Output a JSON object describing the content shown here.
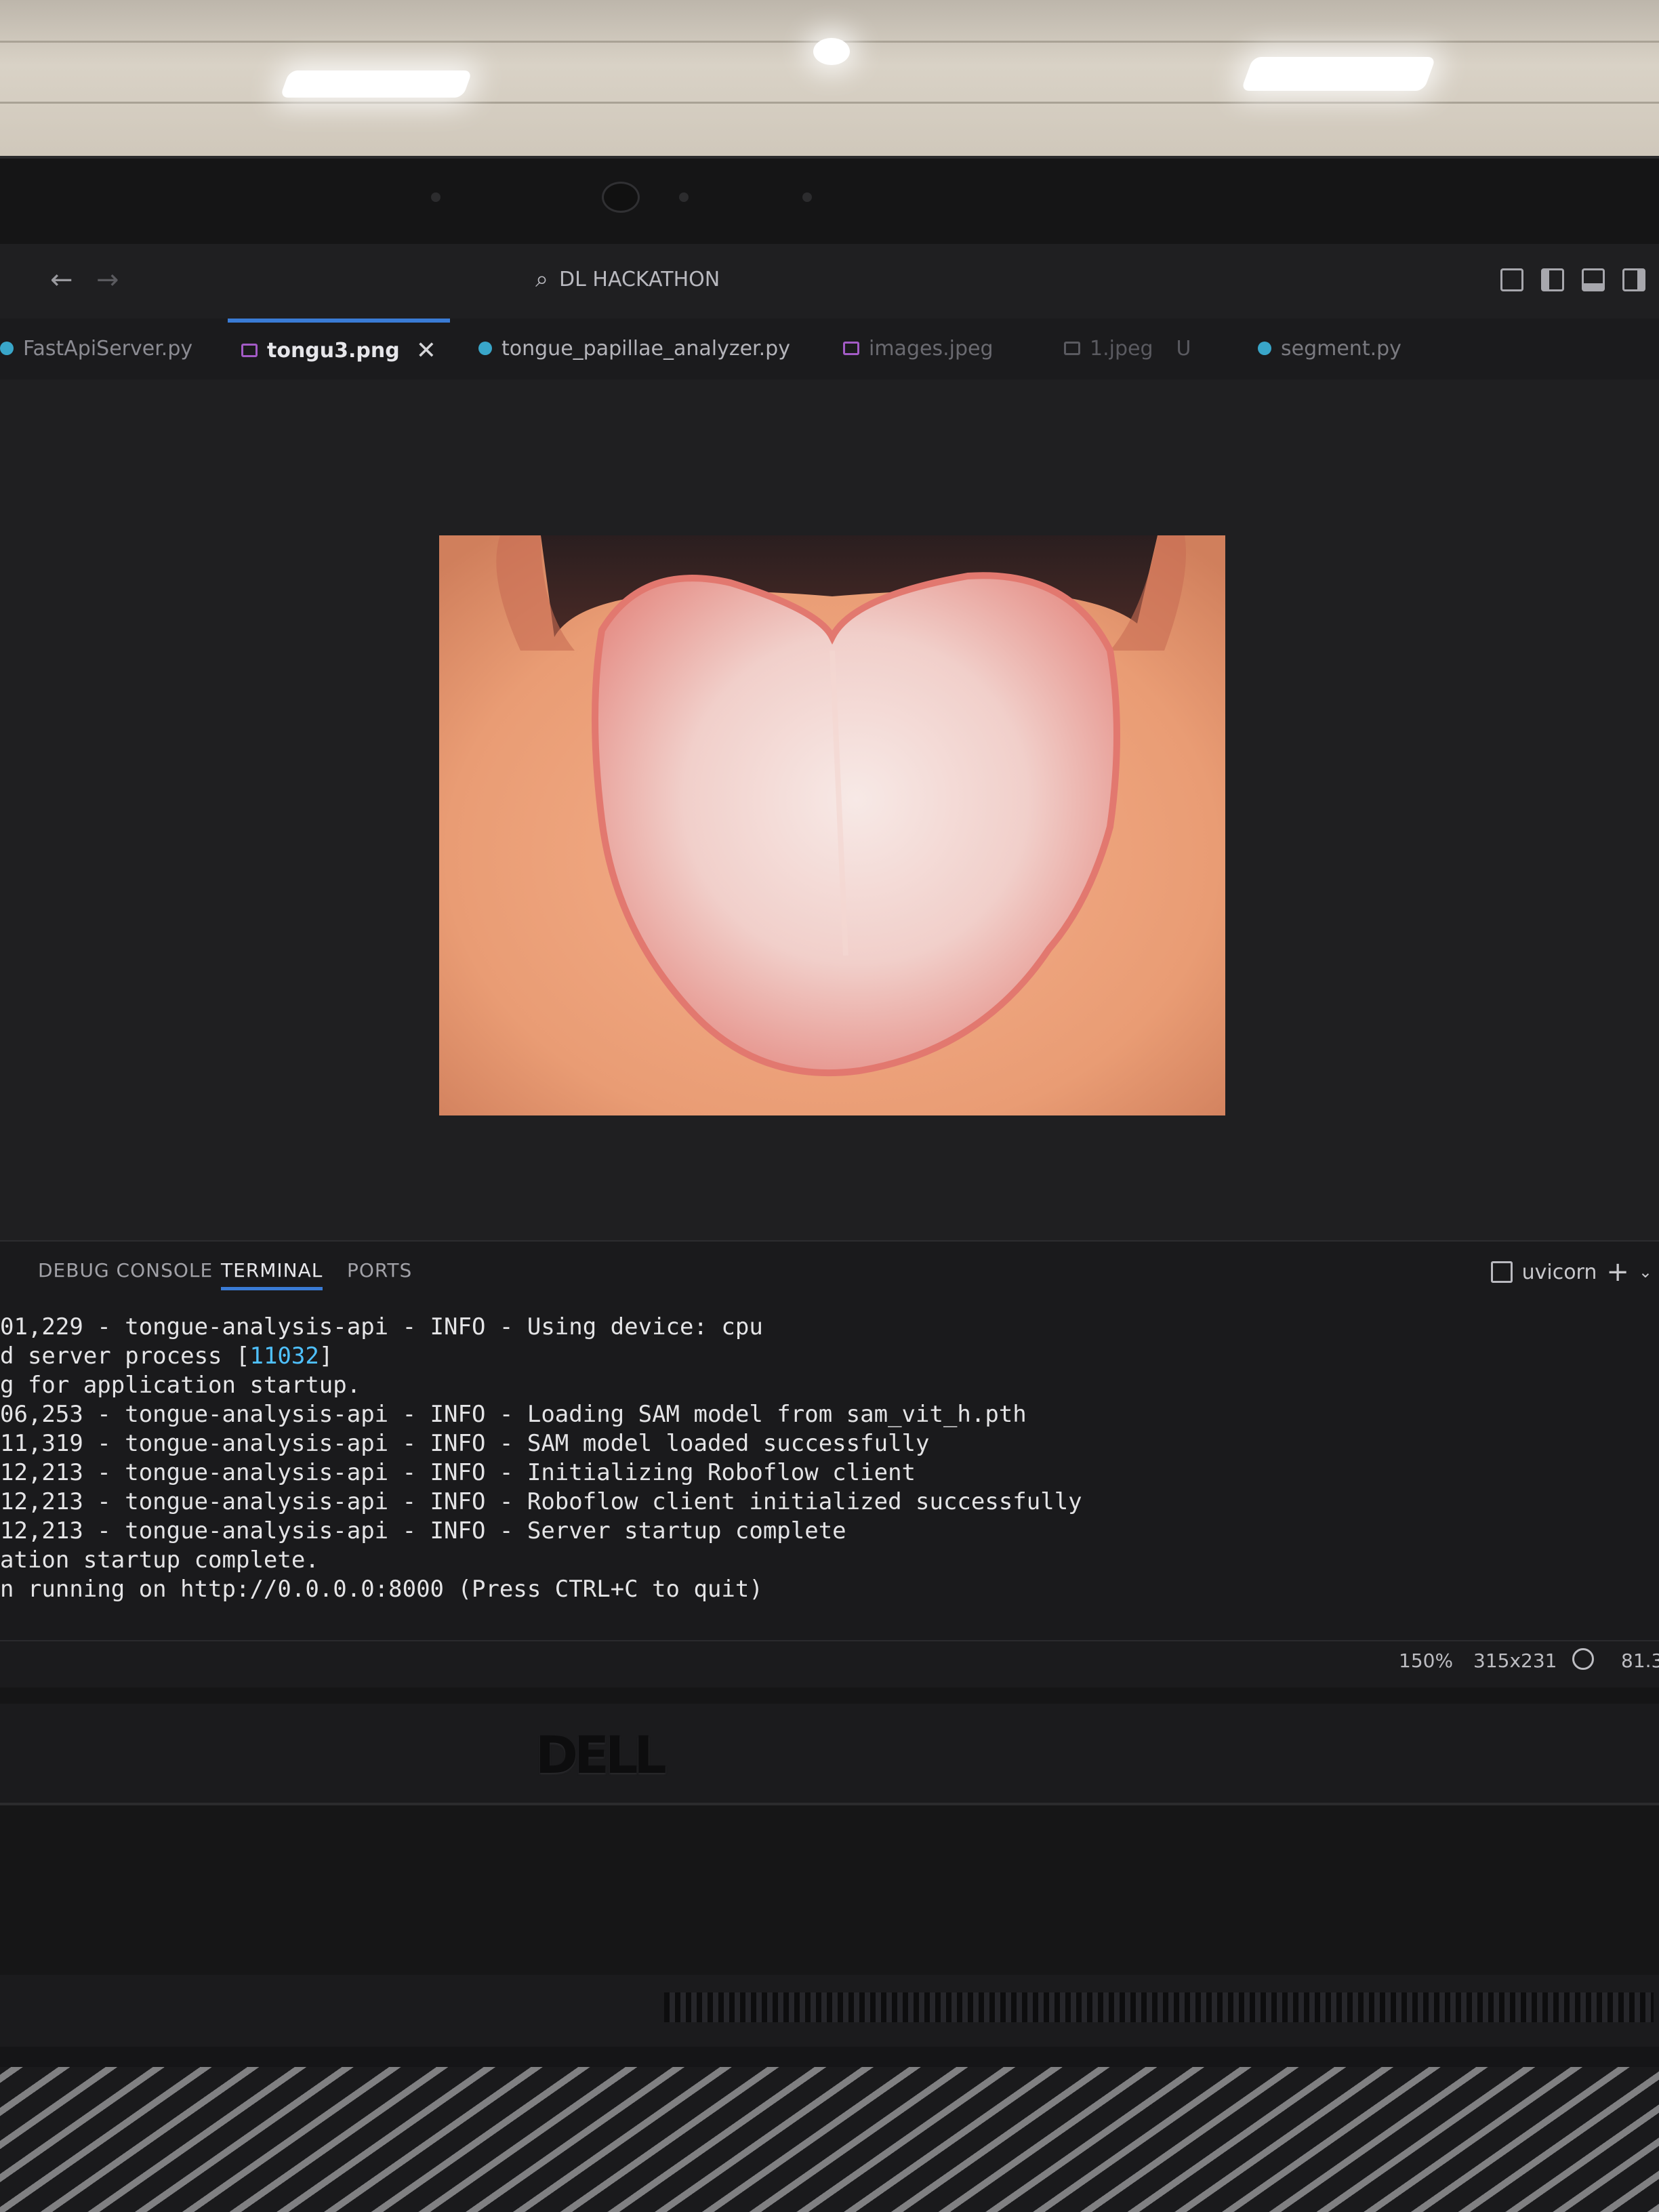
{
  "window": {
    "title": "DL HACKATHON",
    "nav_back_icon": "arrow-left-icon",
    "nav_forward_icon": "arrow-right-icon"
  },
  "tabs": [
    {
      "label": "FastApiServer.py",
      "type": "python"
    },
    {
      "label": "tongu3.png",
      "type": "image",
      "active": true
    },
    {
      "label": "tongue_papillae_analyzer.py",
      "type": "python"
    },
    {
      "label": "images.jpeg",
      "type": "image"
    },
    {
      "label": "1.jpeg",
      "type": "image",
      "badge": "U"
    },
    {
      "label": "segment.py",
      "type": "python"
    }
  ],
  "editor": {
    "image_alt": "tongue photo preview"
  },
  "panel": {
    "tabs": [
      "DEBUG CONSOLE",
      "TERMINAL",
      "PORTS"
    ],
    "active_tab": "TERMINAL",
    "terminal_name": "uvicorn",
    "terminal_lines": [
      "01,229 - tongue-analysis-api - INFO - Using device: cpu",
      "d server process [11032]",
      "g for application startup.",
      "06,253 - tongue-analysis-api - INFO - Loading SAM model from sam_vit_h.pth",
      "11,319 - tongue-analysis-api - INFO - SAM model loaded successfully",
      "12,213 - tongue-analysis-api - INFO - Initializing Roboflow client",
      "12,213 - tongue-analysis-api - INFO - Roboflow client initialized successfully",
      "12,213 - tongue-analysis-api - INFO - Server startup complete",
      "ation startup complete.",
      "n running on http://0.0.0.0:8000 (Press CTRL+C to quit)"
    ],
    "pid": "11032"
  },
  "statusbar": {
    "zoom": "150%",
    "image_size": "315x231",
    "extra": "81.3"
  },
  "brand": "DELL",
  "colors": {
    "accent": "#3a7bd5",
    "terminal_bg": "#1a1a1c",
    "pid": "#4fc1ff"
  }
}
